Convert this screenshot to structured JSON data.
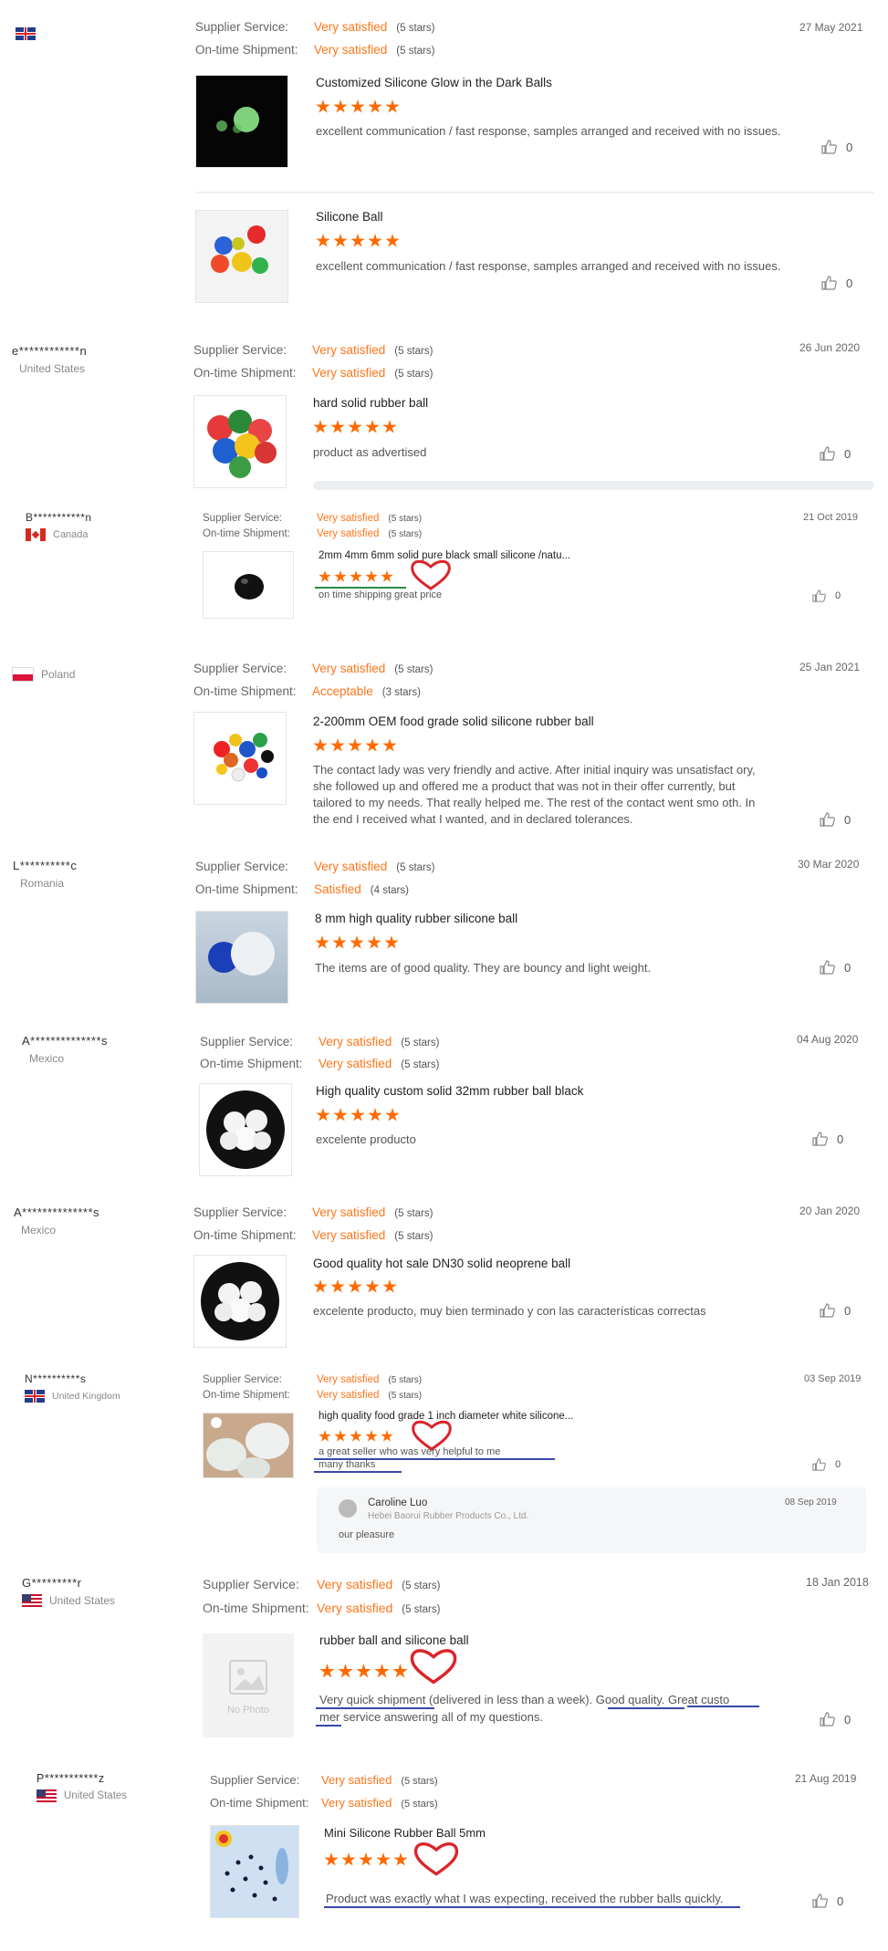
{
  "labels": {
    "supplier_service": "Supplier Service:",
    "on_time_shipment": "On-time Shipment:"
  },
  "icons": {
    "like": "thumbs-up-icon",
    "star": "star-icon",
    "heart": "heart-annotation-icon",
    "no_photo": "image-placeholder-icon"
  },
  "colors": {
    "accent": "#ff7519",
    "star": "#ff6a00",
    "annotation_heart": "#d9252b",
    "annotation_underline": "#3948a8"
  },
  "reviews": [
    {
      "buyer": {
        "name": "",
        "country": "",
        "flag": "gb"
      },
      "date": "27 May 2021",
      "supplier_service": {
        "value": "Very satisfied",
        "stars": "(5 stars)"
      },
      "on_time_shipment": {
        "value": "Very satisfied",
        "stars": "(5 stars)"
      },
      "products": [
        {
          "title": "Customized Silicone Glow in the Dark Balls",
          "rating": 5,
          "comment": "excellent communication / fast response, samples arranged and received with no issues.",
          "likes": "0"
        },
        {
          "title": "Silicone Ball",
          "rating": 5,
          "comment": "excellent communication / fast response, samples arranged and received with no issues.",
          "likes": "0"
        }
      ]
    },
    {
      "buyer": {
        "name": "e************n",
        "country": "United States"
      },
      "date": "26 Jun 2020",
      "supplier_service": {
        "value": "Very satisfied",
        "stars": "(5 stars)"
      },
      "on_time_shipment": {
        "value": "Very satisfied",
        "stars": "(5 stars)"
      },
      "products": [
        {
          "title": "hard solid rubber ball",
          "rating": 5,
          "comment": "product as advertised",
          "likes": "0"
        }
      ]
    },
    {
      "buyer": {
        "name": "B***********n",
        "country": "Canada",
        "flag": "ca"
      },
      "date": "21 Oct 2019",
      "supplier_service": {
        "value": "Very satisfied",
        "stars": "(5 stars)"
      },
      "on_time_shipment": {
        "value": "Very satisfied",
        "stars": "(5 stars)"
      },
      "products": [
        {
          "title": "2mm 4mm 6mm solid pure black small silicone /natu...",
          "rating": 5,
          "comment": "on time shipping great price",
          "likes": "0"
        }
      ]
    },
    {
      "buyer": {
        "name": "",
        "country": "Poland",
        "flag": "pl"
      },
      "date": "25 Jan 2021",
      "supplier_service": {
        "value": "Very satisfied",
        "stars": "(5 stars)"
      },
      "on_time_shipment": {
        "value": "Acceptable",
        "stars": "(3 stars)"
      },
      "products": [
        {
          "title": "2-200mm OEM food grade solid silicone rubber ball",
          "rating": 5,
          "comment": "The contact lady was very friendly and active. After initial inquiry was unsatisfact ory, she followed up and offered me a product that was not in their offer currently, but tailored to my needs. That really helped me. The rest of the contact went smo oth. In the end I received what I wanted, and in declared tolerances.",
          "likes": "0"
        }
      ]
    },
    {
      "buyer": {
        "name": "L**********c",
        "country": "Romania"
      },
      "date": "30 Mar 2020",
      "supplier_service": {
        "value": "Very satisfied",
        "stars": "(5 stars)"
      },
      "on_time_shipment": {
        "value": "Satisfied",
        "stars": "(4 stars)"
      },
      "products": [
        {
          "title": "8 mm high quality rubber silicone ball",
          "rating": 5,
          "comment": "The items are of good quality. They are bouncy and light weight.",
          "likes": "0"
        }
      ]
    },
    {
      "buyer": {
        "name": "A**************s",
        "country": "Mexico"
      },
      "date": "04 Aug 2020",
      "supplier_service": {
        "value": "Very satisfied",
        "stars": "(5 stars)"
      },
      "on_time_shipment": {
        "value": "Very satisfied",
        "stars": "(5 stars)"
      },
      "products": [
        {
          "title": "High quality custom solid 32mm rubber ball black",
          "rating": 5,
          "comment": "excelente producto",
          "likes": "0"
        }
      ]
    },
    {
      "buyer": {
        "name": "A**************s",
        "country": "Mexico"
      },
      "date": "20 Jan 2020",
      "supplier_service": {
        "value": "Very satisfied",
        "stars": "(5 stars)"
      },
      "on_time_shipment": {
        "value": "Very satisfied",
        "stars": "(5 stars)"
      },
      "products": [
        {
          "title": "Good quality hot sale DN30 solid neoprene ball",
          "rating": 5,
          "comment": "excelente producto, muy bien terminado y con las características correctas",
          "likes": "0"
        }
      ]
    },
    {
      "buyer": {
        "name": "N**********s",
        "country": "United Kingdom",
        "flag": "gb"
      },
      "date": "03 Sep 2019",
      "supplier_service": {
        "value": "Very satisfied",
        "stars": "(5 stars)"
      },
      "on_time_shipment": {
        "value": "Very satisfied",
        "stars": "(5 stars)"
      },
      "products": [
        {
          "title": "high quality food grade 1 inch diameter white silicone...",
          "rating": 5,
          "comment_line1": "a great seller who was very helpful to me",
          "comment_line2": "many thanks",
          "likes": "0"
        }
      ],
      "reply": {
        "name": "Caroline Luo",
        "company": "Hebei Baorui Rubber Products Co., Ltd.",
        "date": "08 Sep 2019",
        "text": "our pleasure"
      }
    },
    {
      "buyer": {
        "name": "G*********r",
        "country": "United States",
        "flag": "us"
      },
      "date": "18 Jan 2018",
      "supplier_service": {
        "value": "Very satisfied",
        "stars": "(5 stars)"
      },
      "on_time_shipment": {
        "value": "Very satisfied",
        "stars": "(5 stars)"
      },
      "products": [
        {
          "title": "rubber ball and silicone ball",
          "rating": 5,
          "comment_line1": "Very quick shipment (delivered in less than a week). Good quality. Great custo",
          "comment_line2": "mer service answering all of my questions.",
          "no_photo": "No Photo",
          "likes": "0"
        }
      ]
    },
    {
      "buyer": {
        "name": "P***********z",
        "country": "United States",
        "flag": "us"
      },
      "date": "21 Aug 2019",
      "supplier_service": {
        "value": "Very satisfied",
        "stars": "(5 stars)"
      },
      "on_time_shipment": {
        "value": "Very satisfied",
        "stars": "(5 stars)"
      },
      "products": [
        {
          "title": "Mini Silicone Rubber Ball 5mm",
          "rating": 5,
          "comment": "Product was exactly what I was expecting, received the rubber balls quickly.",
          "likes": "0"
        }
      ]
    }
  ]
}
